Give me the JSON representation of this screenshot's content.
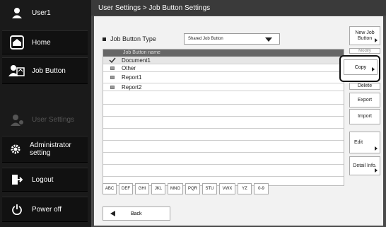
{
  "sidebar": {
    "user": "User1",
    "items": [
      {
        "label": "Home",
        "icon": "home-icon"
      },
      {
        "label": "Job Button",
        "icon": "job-button-icon"
      },
      {
        "label": "User Settings",
        "icon": "user-settings-icon"
      },
      {
        "label": "Administrator setting",
        "icon": "gear-icon"
      },
      {
        "label": "Logout",
        "icon": "logout-icon"
      },
      {
        "label": "Power off",
        "icon": "power-icon"
      }
    ]
  },
  "header": {
    "breadcrumb": "User Settings > Job Button Settings"
  },
  "job_type": {
    "label": "Job Button Type",
    "value": "Shared Job Button"
  },
  "list": {
    "column": "Job Button name",
    "rows": [
      {
        "name": "Document1",
        "selected": true
      },
      {
        "name": "Other",
        "selected": false
      },
      {
        "name": "Report1",
        "selected": false
      },
      {
        "name": "Report2",
        "selected": false
      }
    ]
  },
  "alpha": [
    "ABC",
    "DEF",
    "GHI",
    "JKL",
    "MNO",
    "PQR",
    "STU",
    "VWX",
    "YZ",
    "0-9"
  ],
  "back_label": "Back",
  "actions": {
    "new": "New Job Button",
    "modify": "Modify",
    "copy": "Copy",
    "delete": "Delete",
    "export": "Export",
    "import": "Import",
    "edit": "Edit",
    "detail": "Detail Info."
  }
}
